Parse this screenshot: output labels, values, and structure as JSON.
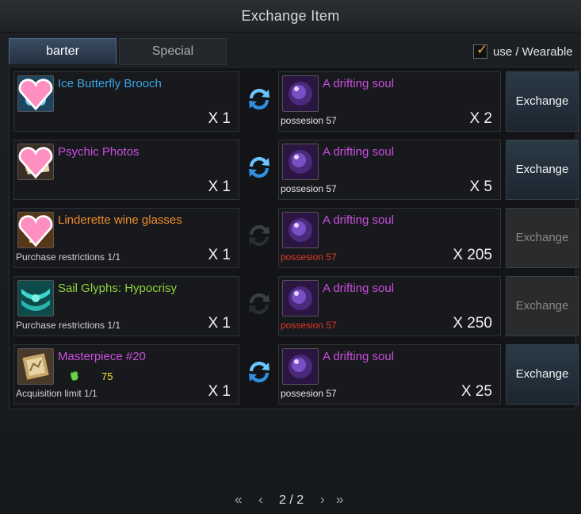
{
  "window": {
    "title": "Exchange Item"
  },
  "tabs": [
    {
      "label": "barter",
      "active": true
    },
    {
      "label": "Special",
      "active": false
    }
  ],
  "filter": {
    "label": "use / Wearable",
    "checked": true
  },
  "button_label": "Exchange",
  "rows": [
    {
      "item": {
        "name": "Ice Butterfly Brooch",
        "name_color": "#3aa6e6",
        "icon": "butterfly-brooch-icon",
        "note": "",
        "qty": "X 1"
      },
      "swap_active": true,
      "cost": {
        "name": "A drifting soul",
        "name_color": "#cb4ee0",
        "icon": "drifting-soul-icon",
        "possession": "possesion 57",
        "possession_color": "#e6e6e6",
        "qty": "X 2"
      },
      "button_enabled": true
    },
    {
      "item": {
        "name": "Psychic Photos",
        "name_color": "#cb4ee0",
        "icon": "photos-icon",
        "note": "",
        "qty": "X 1"
      },
      "swap_active": true,
      "cost": {
        "name": "A drifting soul",
        "name_color": "#cb4ee0",
        "icon": "drifting-soul-icon",
        "possession": "possesion 57",
        "possession_color": "#e6e6e6",
        "qty": "X 5"
      },
      "button_enabled": true
    },
    {
      "item": {
        "name": "Linderette wine glasses",
        "name_color": "#ee8a2c",
        "icon": "wine-glass-icon",
        "note": "Purchase restrictions 1/1",
        "qty": "X 1"
      },
      "swap_active": false,
      "cost": {
        "name": "A drifting soul",
        "name_color": "#cb4ee0",
        "icon": "drifting-soul-icon",
        "possession": "possesion 57",
        "possession_color": "#e03a2a",
        "qty": "X 205"
      },
      "button_enabled": false
    },
    {
      "item": {
        "name": "Sail Glyphs: Hypocrisy",
        "name_color": "#8fd53a",
        "icon": "sail-glyph-icon",
        "note": "Purchase restrictions 1/1",
        "qty": "X 1"
      },
      "swap_active": false,
      "cost": {
        "name": "A drifting soul",
        "name_color": "#cb4ee0",
        "icon": "drifting-soul-icon",
        "possession": "possesion 57",
        "possession_color": "#e03a2a",
        "qty": "X 250"
      },
      "button_enabled": false
    },
    {
      "item": {
        "name": "Masterpiece #20",
        "name_color": "#cb4ee0",
        "icon": "masterpiece-icon",
        "note": "Acquisition limit 1/1",
        "qty": "X 1",
        "stat_icon": "fist-icon",
        "stat_value": "75"
      },
      "swap_active": true,
      "cost": {
        "name": "A drifting soul",
        "name_color": "#cb4ee0",
        "icon": "drifting-soul-icon",
        "possession": "possesion 57",
        "possession_color": "#e6e6e6",
        "qty": "X 25"
      },
      "button_enabled": true
    }
  ],
  "pagination": {
    "text": "2 / 2",
    "first": "first-page-icon",
    "prev": "prev-page-icon",
    "next": "next-page-icon",
    "last": "last-page-icon"
  }
}
